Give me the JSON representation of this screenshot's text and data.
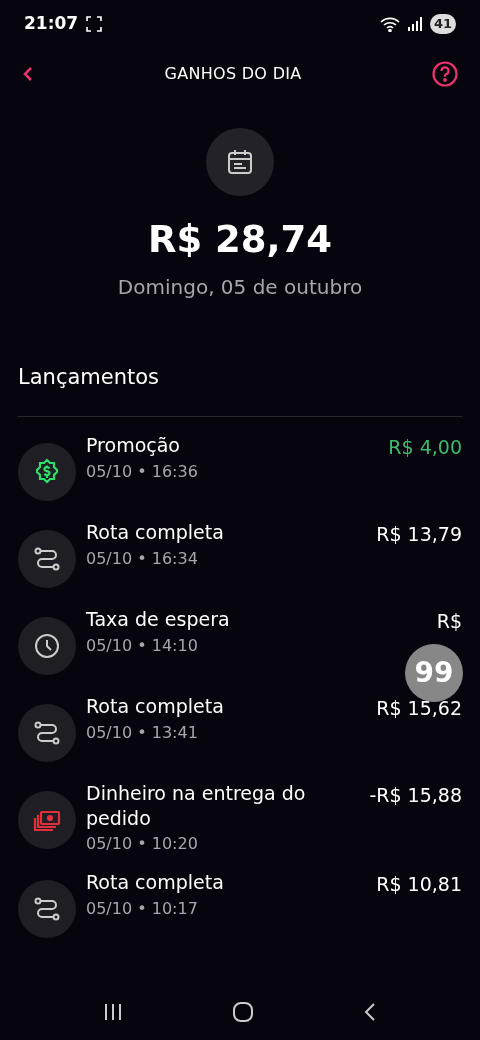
{
  "status_bar": {
    "time": "21:07",
    "battery": "41"
  },
  "header": {
    "title": "GANHOS DO DIA"
  },
  "summary": {
    "total": "R$ 28,74",
    "date": "Domingo, 05 de outubro"
  },
  "section_title": "Lançamentos",
  "entries": [
    {
      "kind": "promo",
      "title": "Promoção",
      "datetime": "05/10 • 16:36",
      "amount": "R$ 4,00",
      "positive": true
    },
    {
      "kind": "route",
      "title": "Rota completa",
      "datetime": "05/10 • 16:34",
      "amount": "R$ 13,79",
      "positive": false
    },
    {
      "kind": "clock",
      "title": "Taxa de espera",
      "datetime": "05/10 • 14:10",
      "amount": "R$",
      "positive": false
    },
    {
      "kind": "route",
      "title": "Rota completa",
      "datetime": "05/10 • 13:41",
      "amount": "R$ 15,62",
      "positive": false
    },
    {
      "kind": "cash",
      "title": "Dinheiro na entrega do pedido",
      "datetime": "05/10 • 10:20",
      "amount": "-R$ 15,88",
      "positive": false
    },
    {
      "kind": "route",
      "title": "Rota completa",
      "datetime": "05/10 • 10:17",
      "amount": "R$ 10,81",
      "positive": false
    }
  ],
  "floating_bubble": {
    "text": "99"
  }
}
